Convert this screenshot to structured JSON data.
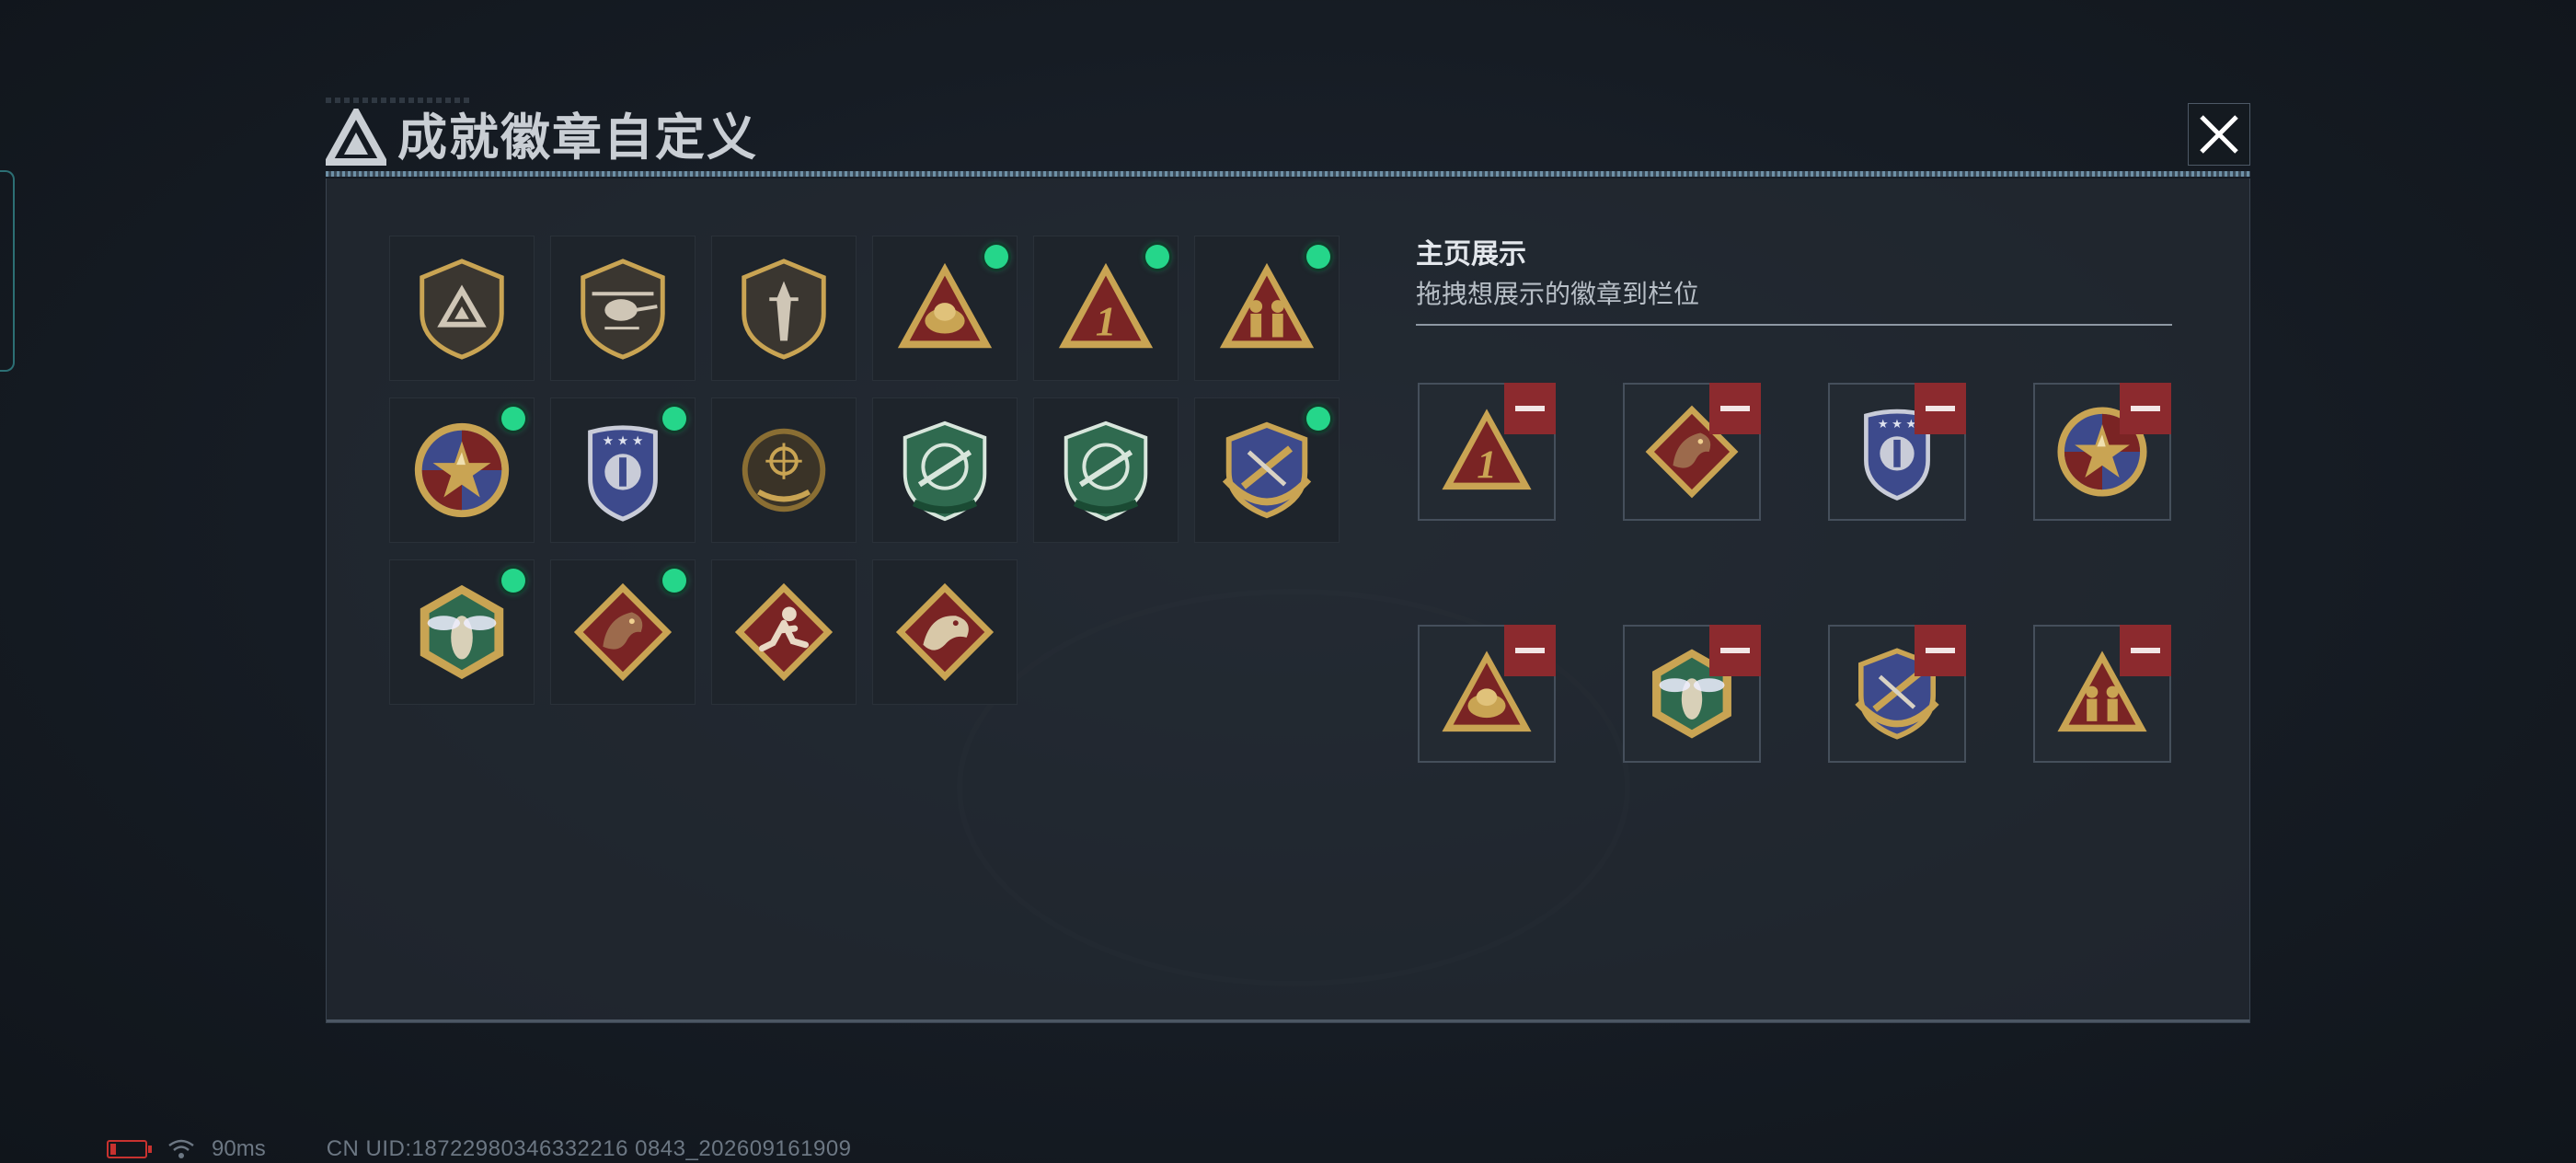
{
  "dialog": {
    "title": "成就徽章自定义",
    "close_icon": "close-icon"
  },
  "collection": {
    "badges": [
      {
        "icon": "delta-shield-badge",
        "equipped": false
      },
      {
        "icon": "helicopter-shield-badge",
        "equipped": false
      },
      {
        "icon": "dagger-shield-badge",
        "equipped": false
      },
      {
        "icon": "triangle-egg-badge",
        "equipped": true
      },
      {
        "icon": "triangle-number-one-badge",
        "equipped": true
      },
      {
        "icon": "triangle-soldiers-badge",
        "equipped": true
      },
      {
        "icon": "star-medallion-badge",
        "equipped": true
      },
      {
        "icon": "blue-crest-badge",
        "equipped": true
      },
      {
        "icon": "gold-crosshair-emblem-badge",
        "equipped": false
      },
      {
        "icon": "green-rifle-shield-badge",
        "equipped": false
      },
      {
        "icon": "green-rifle-shield-badge-2",
        "equipped": false
      },
      {
        "icon": "gold-blue-shield-laurel-badge",
        "equipped": true
      },
      {
        "icon": "hornet-hexagon-badge",
        "equipped": true
      },
      {
        "icon": "dragon-diamond-badge",
        "equipped": true
      },
      {
        "icon": "runner-diamond-badge",
        "equipped": false
      },
      {
        "icon": "lizard-diamond-badge",
        "equipped": false
      }
    ]
  },
  "showcase": {
    "title": "主页展示",
    "subtitle": "拖拽想展示的徽章到栏位",
    "slots": [
      {
        "icon": "triangle-number-one-badge"
      },
      {
        "icon": "dragon-diamond-badge"
      },
      {
        "icon": "blue-crest-badge"
      },
      {
        "icon": "star-medallion-badge"
      },
      {
        "icon": "triangle-egg-badge"
      },
      {
        "icon": "hornet-hexagon-badge"
      },
      {
        "icon": "gold-blue-shield-laurel-badge"
      },
      {
        "icon": "triangle-soldiers-badge"
      }
    ],
    "remove_icon": "minus-icon"
  },
  "status_bar": {
    "latency": "90ms",
    "uid": "CN UID:18722980346332216 0843_202609161909"
  },
  "colors": {
    "equipped_dot": "#25d68a",
    "remove_button": "#8c2a2e",
    "gold": "#c9a453",
    "crimson": "#7a2424"
  }
}
